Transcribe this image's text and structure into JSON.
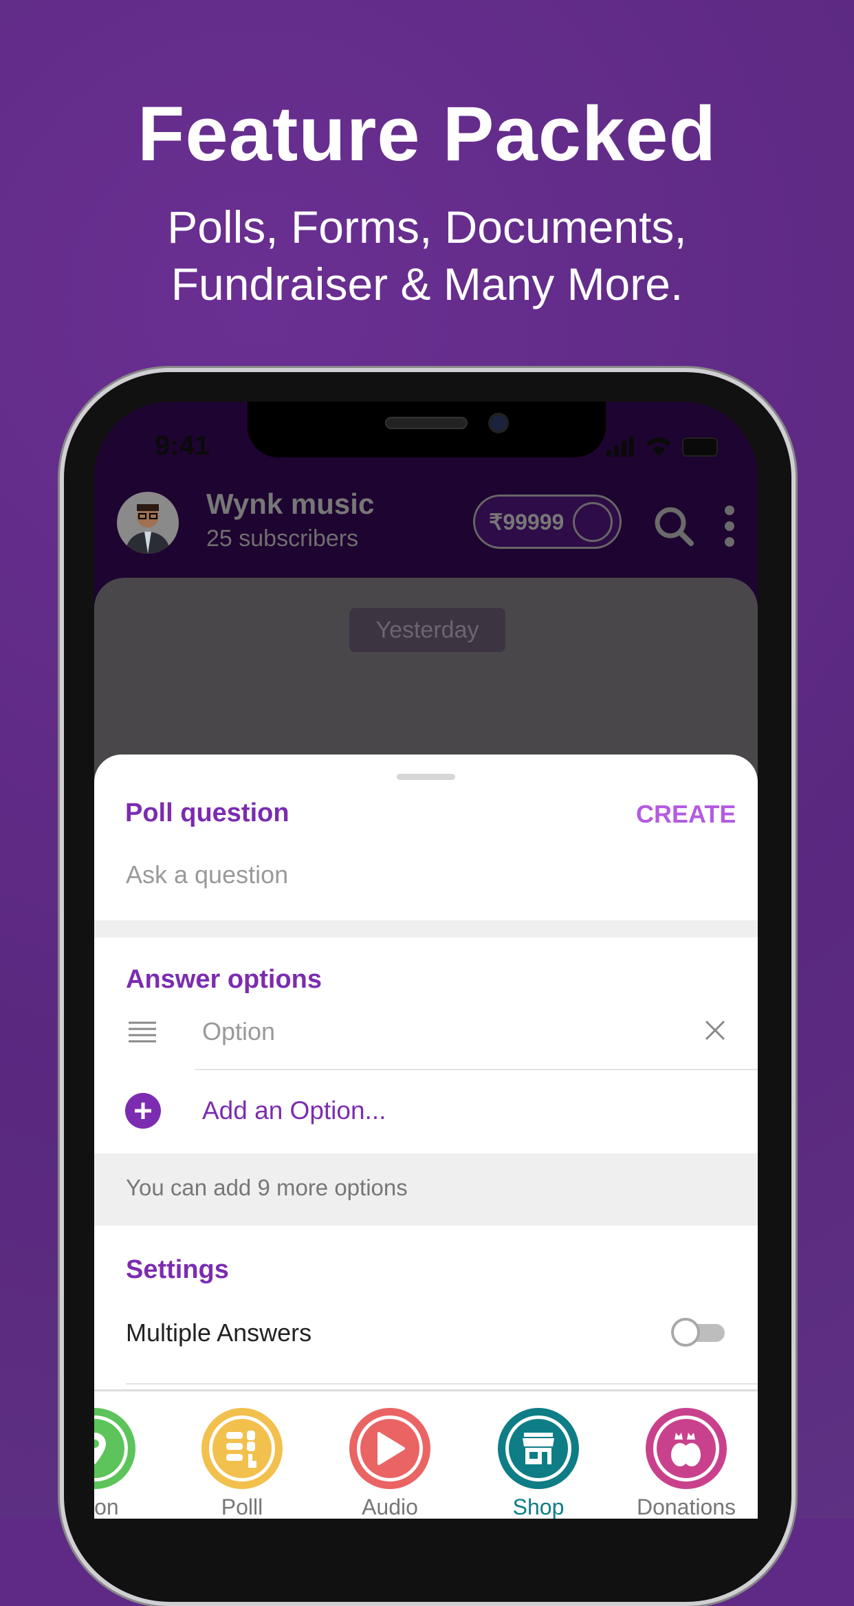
{
  "promo": {
    "title": "Feature Packed",
    "subtitle_line1": "Polls, Forms, Documents,",
    "subtitle_line2": "Fundraiser & Many More."
  },
  "status_bar": {
    "time": "9:41"
  },
  "header": {
    "channel_name": "Wynk music",
    "subscribers": "25 subscribers",
    "balance": "₹99999"
  },
  "chat": {
    "date_chip": "Yesterday"
  },
  "poll_sheet": {
    "question_label": "Poll question",
    "create_label": "CREATE",
    "question_placeholder": "Ask a question",
    "answer_options_label": "Answer options",
    "option_placeholder": "Option",
    "add_option_label": "Add an Option...",
    "remaining_hint": "You can add 9 more options",
    "settings_label": "Settings",
    "multiple_answers_label": "Multiple Answers",
    "multiple_answers_enabled": false
  },
  "bottom_bar": {
    "items": [
      {
        "label": "ation",
        "icon": "location-icon",
        "color": "#5cc45a"
      },
      {
        "label": "Polll",
        "icon": "poll-icon",
        "color": "#f2c04d"
      },
      {
        "label": "Audio",
        "icon": "play-icon",
        "color": "#ea6464"
      },
      {
        "label": "Shop",
        "icon": "shop-icon",
        "color": "#0e7d86",
        "active": true
      },
      {
        "label": "Donations",
        "icon": "money-bag-icon",
        "color": "#c9418c"
      }
    ]
  },
  "colors": {
    "accent": "#7b2cb0",
    "create": "#b45be0",
    "background": "#5f2a85"
  }
}
